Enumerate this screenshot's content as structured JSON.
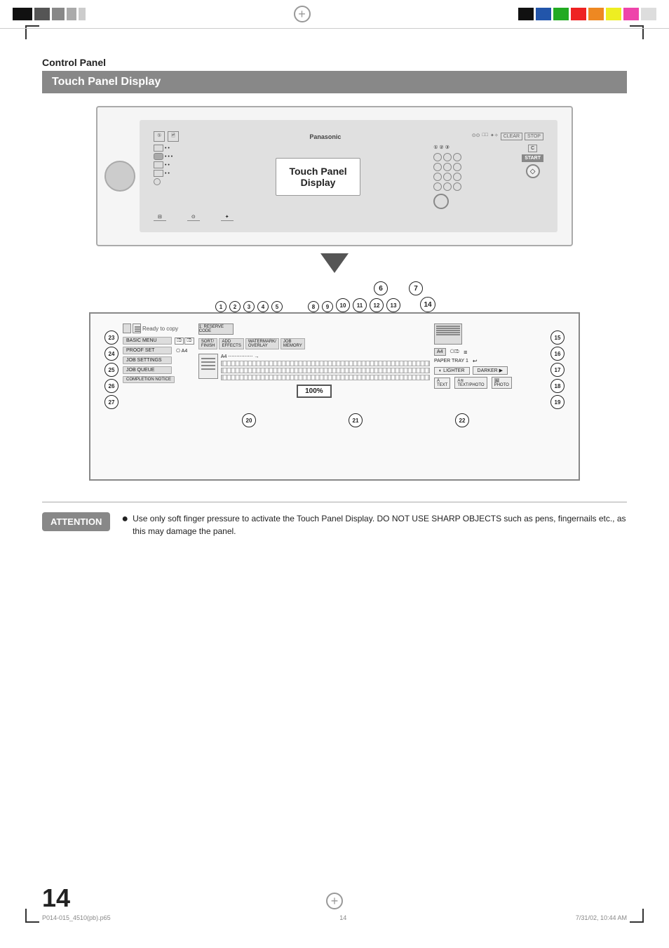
{
  "page": {
    "number": "14"
  },
  "header": {
    "section": "Control Panel",
    "title": "Touch Panel Display"
  },
  "printer": {
    "brand": "Panasonic",
    "touch_label_line1": "Touch Panel",
    "touch_label_line2": "Display"
  },
  "attention": {
    "badge": "ATTENTION",
    "text": "Use only soft finger pressure to activate the Touch Panel Display. DO NOT USE SHARP OBJECTS such as pens, fingernails etc., as this may damage the panel."
  },
  "footer": {
    "left": "P014-015_4510(pb).p65",
    "center": "14",
    "right": "7/31/02, 10:44 AM"
  },
  "diagram": {
    "numbers": {
      "top_large": [
        "6",
        "7"
      ],
      "top_medium": [
        "1",
        "2",
        "3",
        "4",
        "5",
        "8",
        "9",
        "10",
        "11",
        "12",
        "13",
        "14"
      ],
      "left_side": [
        "23",
        "24",
        "25",
        "26",
        "27"
      ],
      "right_side": [
        "15",
        "16",
        "17",
        "18",
        "19"
      ],
      "bottom": [
        "20",
        "21",
        "22"
      ]
    },
    "left_panel": {
      "items": [
        {
          "label": "BASIC MENU"
        },
        {
          "label": "PROOF SET"
        },
        {
          "label": "JOB SETTINGS"
        },
        {
          "label": "JOB QUEUE"
        },
        {
          "label": "COMPLETION NOTICE"
        }
      ]
    },
    "center_panel": {
      "copy_text": "Ready to copy",
      "percentage": "100%"
    },
    "right_panel": {
      "items": [
        {
          "label": "A4"
        },
        {
          "label": "PAPER TRAY 1"
        },
        {
          "label": "LIGHTER | DARKER"
        },
        {
          "label": "TEXT | TEXT/PHOTO | PHOTO"
        }
      ]
    }
  },
  "colors": {
    "top_bar_blocks": [
      "#111",
      "#333",
      "#555",
      "#777",
      "#999"
    ],
    "color_swatches": [
      "#1a1a1a",
      "#2255aa",
      "#22aa22",
      "#ee2222",
      "#ee8822",
      "#eeee22",
      "#ee44aa",
      "#dddddd"
    ],
    "title_bg": "#888888",
    "attention_badge_bg": "#888888"
  }
}
